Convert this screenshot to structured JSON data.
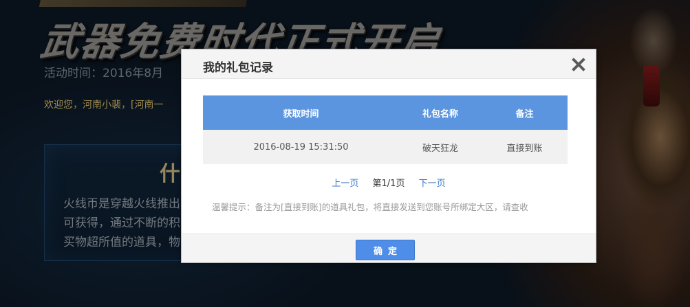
{
  "background": {
    "banner_title": "武器免费时代正式开启",
    "event_time": "活动时间：2016年8月",
    "welcome": "欢迎您，河南小裴，[河南一",
    "panel_heading": "什",
    "panel_lines": [
      "火线币是穿越火线推出",
      "可获得，通过不断的积",
      "买物超所值的道具，物"
    ]
  },
  "dialog": {
    "title": "我的礼包记录",
    "table": {
      "headers": [
        "获取时间",
        "礼包名称",
        "备注"
      ],
      "rows": [
        [
          "2016-08-19 15:31:50",
          "破天狂龙",
          "直接到账"
        ]
      ]
    },
    "pager": {
      "prev": "上一页",
      "current": "第1/1页",
      "next": "下一页"
    },
    "tip": "温馨提示：备注为[直接到账]的道具礼包，将直接发送到您账号所绑定大区，请查收",
    "ok_label": "确定"
  },
  "colors": {
    "table_header": "#5b95e0",
    "ok_button": "#4e8de8",
    "link": "#3a78c8",
    "dialog_header_bg": "#f4f4f4"
  },
  "icons": {
    "close": "close-icon"
  }
}
